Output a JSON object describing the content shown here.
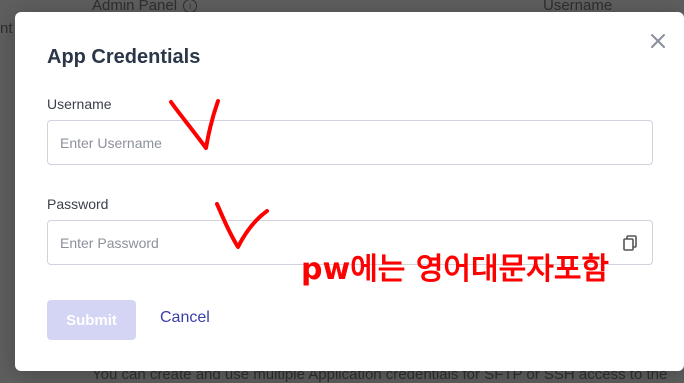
{
  "backdrop": {
    "admin_panel": "Admin Panel",
    "info_glyph": "i",
    "username_col": "Username",
    "left_fragment": "nt",
    "bottom_text": "You can create and use multiple Application credentials for SFTP or SSH access to the"
  },
  "modal": {
    "title": "App Credentials",
    "close_icon": "close-icon",
    "username": {
      "label": "Username",
      "placeholder": "Enter Username",
      "value": ""
    },
    "password": {
      "label": "Password",
      "placeholder": "Enter Password",
      "value": "",
      "icon": "password-manager-icon"
    },
    "submit_label": "Submit",
    "cancel_label": "Cancel"
  },
  "annotations": {
    "note": "pw에는 영어대문자포함",
    "color": "#ff0000"
  },
  "colors": {
    "title": "#2b3648",
    "submit_bg": "#d4d4f4",
    "cancel": "#3a3fa8",
    "overlay": "#5f5f5f"
  }
}
